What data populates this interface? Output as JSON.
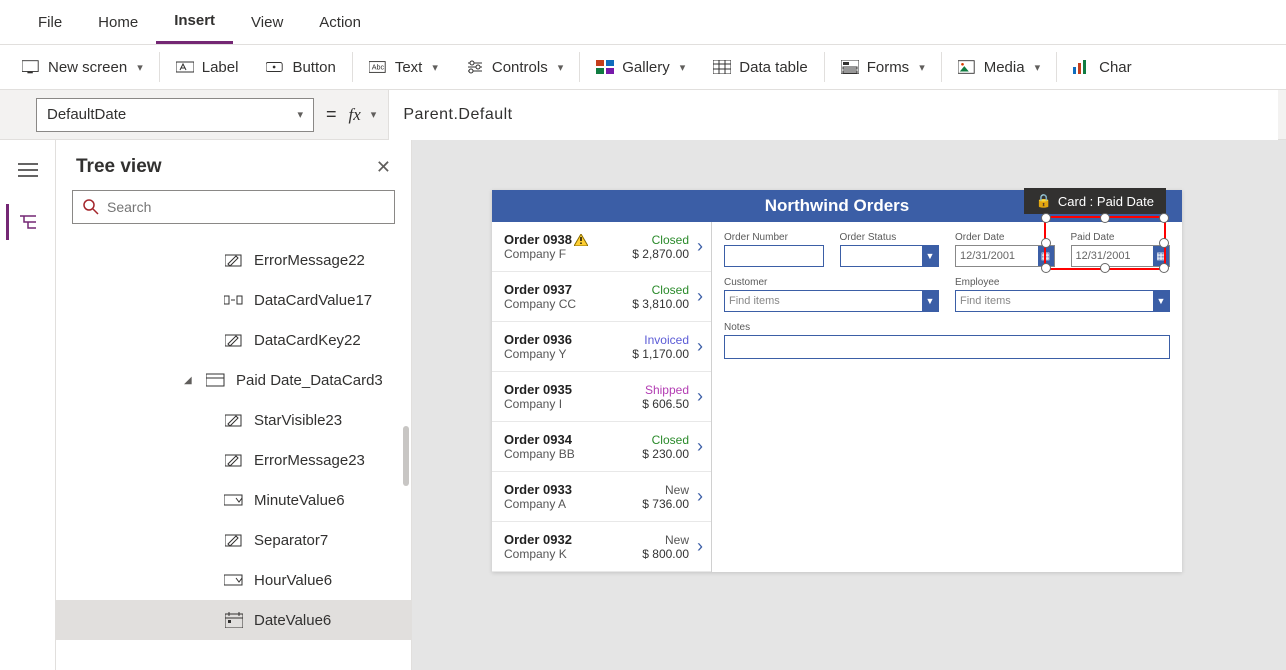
{
  "menubar": [
    "File",
    "Home",
    "Insert",
    "View",
    "Action"
  ],
  "menubar_active_index": 2,
  "ribbon": {
    "new_screen": "New screen",
    "label": "Label",
    "button": "Button",
    "text": "Text",
    "controls": "Controls",
    "gallery": "Gallery",
    "data_table": "Data table",
    "forms": "Forms",
    "media": "Media",
    "char": "Char"
  },
  "property_selector": "DefaultDate",
  "formula": "Parent.Default",
  "tree": {
    "title": "Tree view",
    "search_placeholder": "Search",
    "items": [
      {
        "label": "ErrorMessage22",
        "indent": 2,
        "icon": "edit"
      },
      {
        "label": "DataCardValue17",
        "indent": 2,
        "icon": "combo"
      },
      {
        "label": "DataCardKey22",
        "indent": 2,
        "icon": "edit"
      },
      {
        "label": "Paid Date_DataCard3",
        "indent": 1,
        "icon": "card",
        "expanded": true
      },
      {
        "label": "StarVisible23",
        "indent": 2,
        "icon": "edit"
      },
      {
        "label": "ErrorMessage23",
        "indent": 2,
        "icon": "edit"
      },
      {
        "label": "MinuteValue6",
        "indent": 2,
        "icon": "dropdown"
      },
      {
        "label": "Separator7",
        "indent": 2,
        "icon": "edit"
      },
      {
        "label": "HourValue6",
        "indent": 2,
        "icon": "dropdown"
      },
      {
        "label": "DateValue6",
        "indent": 2,
        "icon": "date",
        "selected": true
      }
    ]
  },
  "app": {
    "title": "Northwind Orders",
    "orders": [
      {
        "num": "Order 0938",
        "warn": true,
        "company": "Company F",
        "status": "Closed",
        "amount": "$ 2,870.00"
      },
      {
        "num": "Order 0937",
        "company": "Company CC",
        "status": "Closed",
        "amount": "$ 3,810.00"
      },
      {
        "num": "Order 0936",
        "company": "Company Y",
        "status": "Invoiced",
        "amount": "$ 1,170.00"
      },
      {
        "num": "Order 0935",
        "company": "Company I",
        "status": "Shipped",
        "amount": "$ 606.50"
      },
      {
        "num": "Order 0934",
        "company": "Company BB",
        "status": "Closed",
        "amount": "$ 230.00"
      },
      {
        "num": "Order 0933",
        "company": "Company A",
        "status": "New",
        "amount": "$ 736.00"
      },
      {
        "num": "Order 0932",
        "company": "Company K",
        "status": "New",
        "amount": "$ 800.00"
      }
    ],
    "form": {
      "order_number_label": "Order Number",
      "order_status_label": "Order Status",
      "order_date_label": "Order Date",
      "order_date_value": "12/31/2001",
      "paid_date_label": "Paid Date",
      "paid_date_value": "12/31/2001",
      "customer_label": "Customer",
      "employee_label": "Employee",
      "find_items": "Find items",
      "notes_label": "Notes"
    }
  },
  "selection_badge": "Card : Paid Date"
}
